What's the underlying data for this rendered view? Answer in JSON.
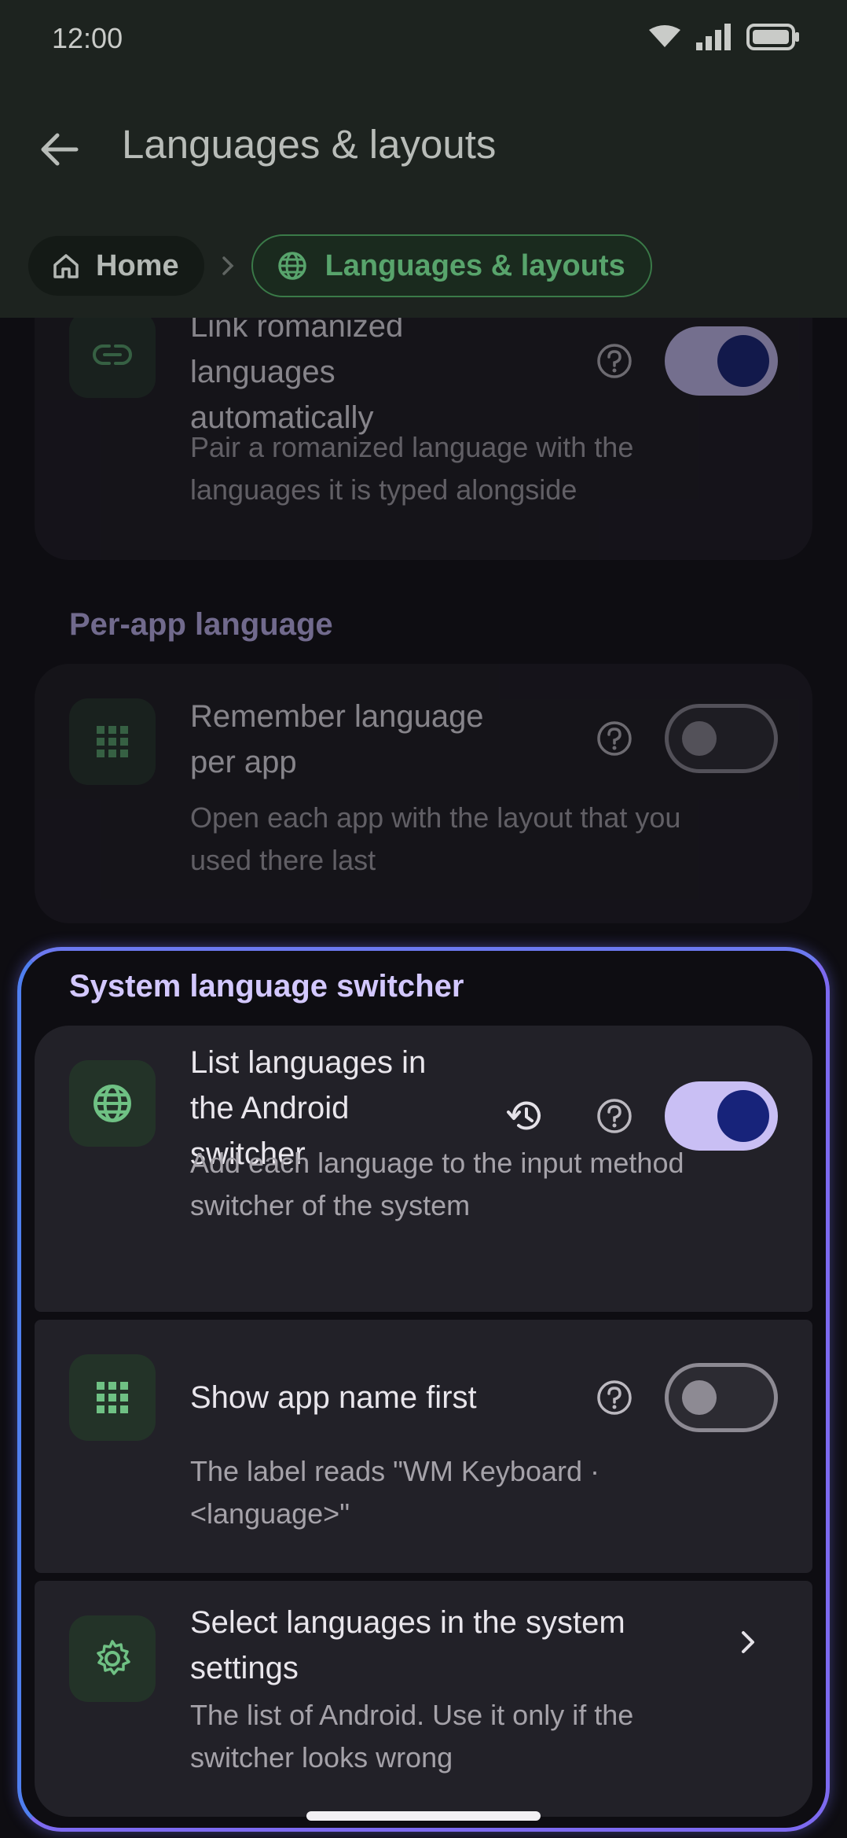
{
  "status": {
    "time": "12:00",
    "icons": [
      "wifi-icon",
      "signal-icon",
      "battery-icon"
    ]
  },
  "app_bar": {
    "title": "Languages & layouts"
  },
  "breadcrumb": {
    "home": "Home",
    "current": "Languages & layouts"
  },
  "link_romanized": {
    "title_lines": [
      "Link romanized",
      "languages",
      "automatically"
    ],
    "subtitle_lines": [
      "Pair a romanized language with the",
      "languages it is typed alongside"
    ],
    "toggle": "on"
  },
  "per_app": {
    "section": "Per-app language",
    "title_lines": [
      "Remember language",
      "per app"
    ],
    "subtitle_lines": [
      "Open each app with the layout that you",
      "used there last"
    ],
    "toggle": "off"
  },
  "system_switcher": {
    "section": "System language switcher",
    "list_languages": {
      "title_lines": [
        "List languages in",
        "the Android",
        "switcher"
      ],
      "subtitle_lines": [
        "Add each language to the input method",
        "switcher of the system"
      ],
      "toggle": "on"
    },
    "app_name_first": {
      "title": "Show app name first",
      "subtitle_lines": [
        "The label reads \"WM Keyboard ·",
        "<language>\""
      ],
      "toggle": "off"
    },
    "select_languages": {
      "title_lines": [
        "Select languages in the system",
        "settings"
      ],
      "subtitle_lines": [
        "The list of Android. Use it only if the",
        "switcher looks wrong"
      ]
    }
  },
  "colors": {
    "accent": "#c9bff4",
    "knob": "#17237a",
    "green": "#58a46c",
    "highlight": "#7d6af0"
  }
}
